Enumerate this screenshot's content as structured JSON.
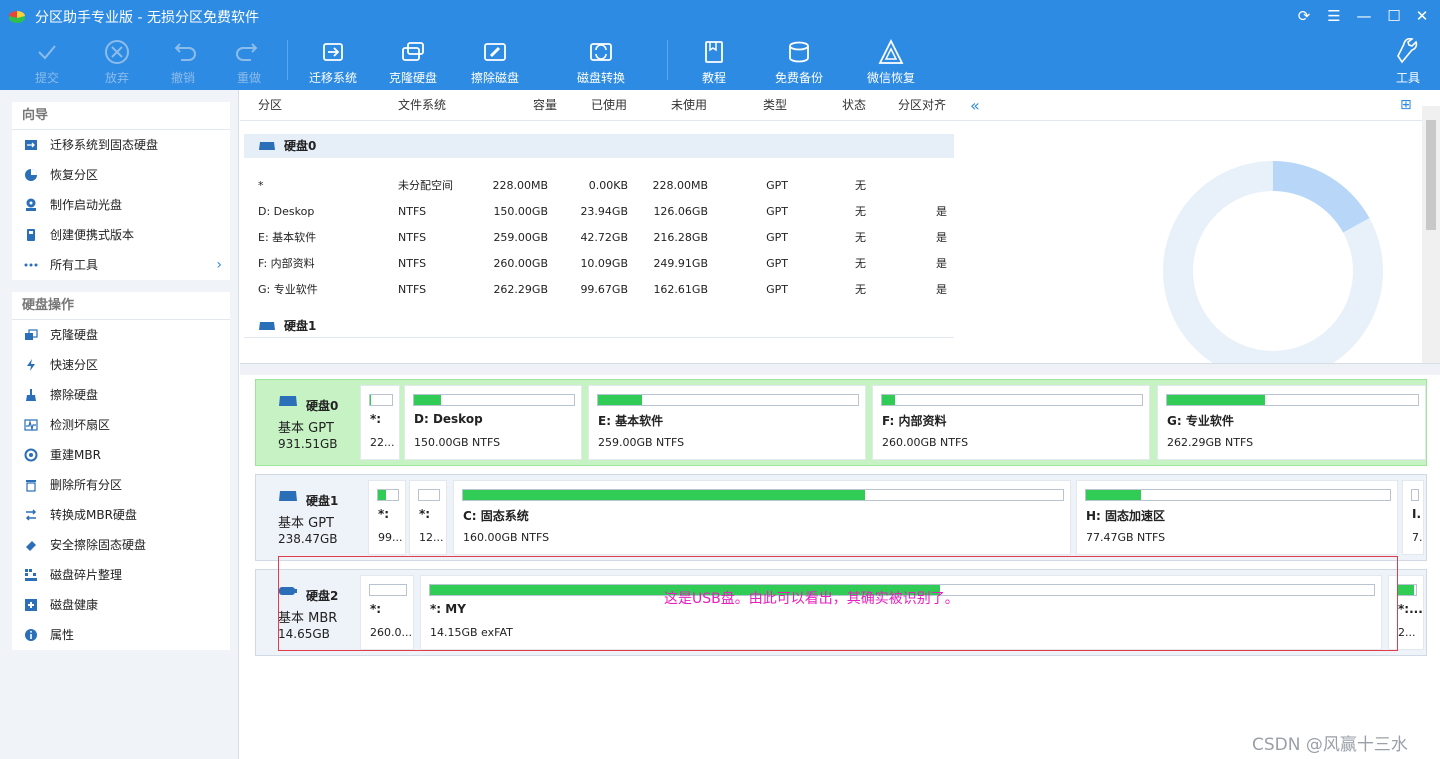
{
  "window": {
    "title": "分区助手专业版 - 无损分区免费软件"
  },
  "toolbar": {
    "commit": "提交",
    "discard": "放弃",
    "undo": "撤销",
    "redo": "重做",
    "migrate_os": "迁移系统",
    "clone_disk": "克隆硬盘",
    "wipe_disk": "擦除磁盘",
    "convert_disk": "磁盘转换",
    "tutorial": "教程",
    "free_backup": "免费备份",
    "wechat_recovery": "微信恢复",
    "tools": "工具"
  },
  "sidebar": {
    "wizard_title": "向导",
    "wizard_items": [
      "迁移系统到固态硬盘",
      "恢复分区",
      "制作启动光盘",
      "创建便携式版本",
      "所有工具"
    ],
    "ops_title": "硬盘操作",
    "ops_items": [
      "克隆硬盘",
      "快速分区",
      "擦除硬盘",
      "检测坏扇区",
      "重建MBR",
      "删除所有分区",
      "转换成MBR硬盘",
      "安全擦除固态硬盘",
      "磁盘碎片整理",
      "磁盘健康",
      "属性"
    ]
  },
  "grid": {
    "headers": {
      "partition": "分区",
      "fs": "文件系统",
      "capacity": "容量",
      "used": "已使用",
      "unused": "未使用",
      "type": "类型",
      "status": "状态",
      "align": "分区对齐",
      "collapse": "«"
    },
    "disk0_label": "硬盘0",
    "disk1_label": "硬盘1",
    "rows": [
      {
        "name": "*",
        "fs": "未分配空间",
        "cap": "228.00MB",
        "used": "0.00KB",
        "unused": "228.00MB",
        "type": "GPT",
        "status": "无",
        "align": ""
      },
      {
        "name": "D: Deskop",
        "fs": "NTFS",
        "cap": "150.00GB",
        "used": "23.94GB",
        "unused": "126.06GB",
        "type": "GPT",
        "status": "无",
        "align": "是"
      },
      {
        "name": "E: 基本软件",
        "fs": "NTFS",
        "cap": "259.00GB",
        "used": "42.72GB",
        "unused": "216.28GB",
        "type": "GPT",
        "status": "无",
        "align": "是"
      },
      {
        "name": "F: 内部资料",
        "fs": "NTFS",
        "cap": "260.00GB",
        "used": "10.09GB",
        "unused": "249.91GB",
        "type": "GPT",
        "status": "无",
        "align": "是"
      },
      {
        "name": "G: 专业软件",
        "fs": "NTFS",
        "cap": "262.29GB",
        "used": "99.67GB",
        "unused": "162.61GB",
        "type": "GPT",
        "status": "无",
        "align": "是"
      }
    ]
  },
  "pie": {
    "used_fraction": 0.17
  },
  "diskmap": {
    "disk0": {
      "name": "硬盘0",
      "type": "基本 GPT",
      "size": "931.51GB",
      "parts": [
        {
          "name": "*:",
          "info": "22...",
          "fill": 0.02
        },
        {
          "name": "D: Deskop",
          "info": "150.00GB NTFS",
          "fill": 0.17
        },
        {
          "name": "E: 基本软件",
          "info": "259.00GB NTFS",
          "fill": 0.17
        },
        {
          "name": "F: 内部资料",
          "info": "260.00GB NTFS",
          "fill": 0.05
        },
        {
          "name": "G: 专业软件",
          "info": "262.29GB NTFS",
          "fill": 0.39
        }
      ]
    },
    "disk1": {
      "name": "硬盘1",
      "type": "基本 GPT",
      "size": "238.47GB",
      "parts": [
        {
          "name": "*:",
          "info": "99...",
          "fill": 0.4
        },
        {
          "name": "*:",
          "info": "12...",
          "fill": 0.0
        },
        {
          "name": "C: 固态系统",
          "info": "160.00GB NTFS",
          "fill": 0.67
        },
        {
          "name": "H: 固态加速区",
          "info": "77.47GB NTFS",
          "fill": 0.18
        },
        {
          "name": "I..",
          "info": "7.",
          "fill": 0.0
        }
      ]
    },
    "disk2": {
      "name": "硬盘2",
      "type": "基本 MBR",
      "size": "14.65GB",
      "parts": [
        {
          "name": "*:",
          "info": "260.0...",
          "fill": 0.0
        },
        {
          "name": "*: MY",
          "info": "14.15GB exFAT",
          "fill": 0.54
        },
        {
          "name": "*:...",
          "info": "2...",
          "fill": 0.9
        }
      ]
    }
  },
  "annotation": "这是USB盘。由此可以看出，其确实被识别了。",
  "watermark": "CSDN @风赢十三水"
}
